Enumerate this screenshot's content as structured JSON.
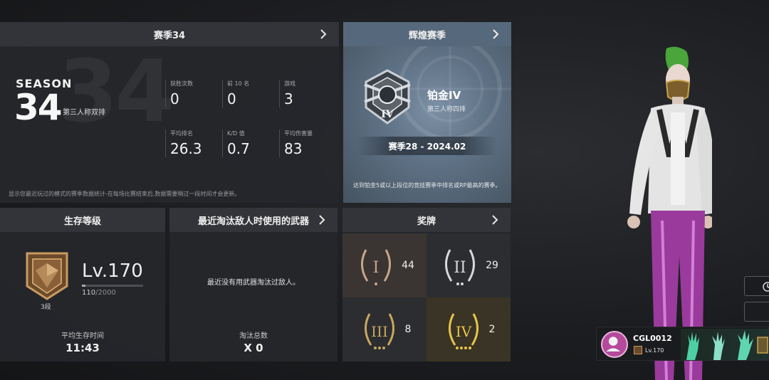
{
  "season": {
    "header": "赛季34",
    "big_number": "34",
    "season_word": "SEASON",
    "season_number": "34",
    "mode": "第三人称双排",
    "stats": [
      {
        "label": "获胜次数",
        "value": "0"
      },
      {
        "label": "前 10 名",
        "value": "0"
      },
      {
        "label": "游戏",
        "value": "3"
      },
      {
        "label": "平均排名",
        "value": "26.3"
      },
      {
        "label": "K/D 值",
        "value": "0.7"
      },
      {
        "label": "平均伤害量",
        "value": "83"
      }
    ],
    "note": "显示您最近玩过的模式的赛季数据统计-在每场比赛结束后,数据需要稍过一段时间才会更新。"
  },
  "glorious": {
    "header": "辉煌赛季",
    "rank_title": "铂金IV",
    "rank_subtitle": "第三人称四排",
    "season_label": "赛季28 - 2024.02",
    "note": "达到铂金5或以上段位的竞技赛季中排名或RP最高的赛季。"
  },
  "survival": {
    "header": "生存等级",
    "level": "Lv.170",
    "xp_current": "110",
    "xp_max": "/2000",
    "xp_fraction": 0.055,
    "tier": "3段",
    "avg_time_label": "平均生存时间",
    "avg_time_value": "11:43"
  },
  "weapon": {
    "header": "最近淘汰敌人时使用的武器",
    "message": "最近没有用武器淘汰过敌人。",
    "kills_label": "淘汰总数",
    "kills_value": "X 0"
  },
  "medals": {
    "header": "奖牌",
    "items": [
      {
        "tier": "I",
        "count": "44",
        "color": "#c8a48a"
      },
      {
        "tier": "II",
        "count": "29",
        "color": "#d8d8d8"
      },
      {
        "tier": "III",
        "count": "8",
        "color": "#c9a65a"
      },
      {
        "tier": "IV",
        "count": "2",
        "color": "#e8c44a"
      }
    ]
  },
  "player": {
    "name": "CGL0012",
    "level": "Lv.170"
  },
  "colors": {
    "panel": "#26272b",
    "panel_header": "#34353a",
    "glory_header": "#56687b",
    "accent_gold": "#e8c44a"
  }
}
